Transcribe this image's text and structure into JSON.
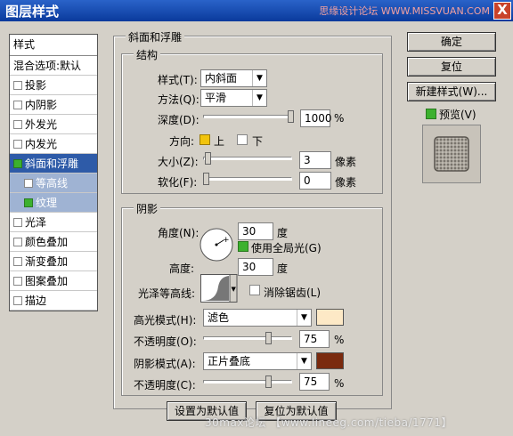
{
  "window": {
    "title": "图层样式",
    "watermark_top": "思缘设计论坛 WWW.MISSVUAN.COM",
    "close": "X"
  },
  "styles_panel": {
    "header": "样式",
    "blend": "混合选项:默认",
    "items": [
      {
        "label": "投影",
        "checked": false
      },
      {
        "label": "内阴影",
        "checked": false
      },
      {
        "label": "外发光",
        "checked": false
      },
      {
        "label": "内发光",
        "checked": false
      },
      {
        "label": "斜面和浮雕",
        "checked": true,
        "selected": true
      },
      {
        "label": "等高线",
        "checked": false,
        "sub": true
      },
      {
        "label": "纹理",
        "checked": true,
        "sub": true
      },
      {
        "label": "光泽",
        "checked": false
      },
      {
        "label": "颜色叠加",
        "checked": false
      },
      {
        "label": "渐变叠加",
        "checked": false
      },
      {
        "label": "图案叠加",
        "checked": false
      },
      {
        "label": "描边",
        "checked": false
      }
    ]
  },
  "bevel": {
    "section_title": "斜面和浮雕",
    "structure": {
      "title": "结构",
      "style_label": "样式(T):",
      "style_value": "内斜面",
      "technique_label": "方法(Q):",
      "technique_value": "平滑",
      "depth_label": "深度(D):",
      "depth_value": "1000",
      "depth_unit": "%",
      "depth_level": 1.0,
      "direction_label": "方向:",
      "direction_up": "上",
      "direction_down": "下",
      "size_label": "大小(Z):",
      "size_value": "3",
      "size_unit": "像素",
      "size_level": 0.02,
      "soften_label": "软化(F):",
      "soften_value": "0",
      "soften_unit": "像素",
      "soften_level": 0.0
    },
    "shading": {
      "title": "阴影",
      "angle_label": "角度(N):",
      "angle_value": "30",
      "angle_unit": "度",
      "global_light": "使用全局光(G)",
      "altitude_label": "高度:",
      "altitude_value": "30",
      "altitude_unit": "度",
      "gloss_contour_label": "光泽等高线:",
      "anti_aliased": "消除锯齿(L)",
      "highlight_mode_label": "高光模式(H):",
      "highlight_mode_value": "滤色",
      "highlight_color": "#fde9c6",
      "highlight_opacity_label": "不透明度(O):",
      "highlight_opacity_value": "75",
      "highlight_opacity_unit": "%",
      "highlight_opacity_level": 0.75,
      "shadow_mode_label": "阴影模式(A):",
      "shadow_mode_value": "正片叠底",
      "shadow_color": "#7a2a0e",
      "shadow_opacity_label": "不透明度(C):",
      "shadow_opacity_value": "75",
      "shadow_opacity_unit": "%",
      "shadow_opacity_level": 0.75
    },
    "make_default": "设置为默认值",
    "reset_default": "复位为默认值"
  },
  "buttons": {
    "ok": "确定",
    "reset": "复位",
    "new_style": "新建样式(W)...",
    "preview": "预览(V)"
  },
  "watermark_bottom": "30max论坛 【www.lineeg.com/tieba/1771】"
}
